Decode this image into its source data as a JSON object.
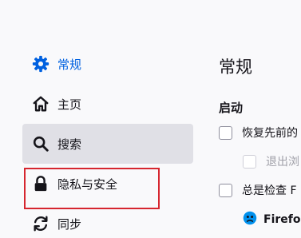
{
  "sidebar": {
    "items": [
      {
        "label": "常规",
        "icon": "gear-icon",
        "selected": true
      },
      {
        "label": "主页",
        "icon": "home-icon"
      },
      {
        "label": "搜索",
        "icon": "search-icon",
        "hovered": true
      },
      {
        "label": "隐私与安全",
        "icon": "lock-icon"
      },
      {
        "label": "同步",
        "icon": "sync-icon"
      }
    ]
  },
  "main": {
    "title": "常规",
    "section_title": "启动",
    "restore_label": "恢复先前的",
    "exit_label": "退出浏",
    "check_label": "总是检查 F",
    "firefox_label": "Firefo"
  },
  "colors": {
    "accent": "#0061e0",
    "highlight_border": "#d6262f",
    "hover_background": "#e0e0e6"
  }
}
